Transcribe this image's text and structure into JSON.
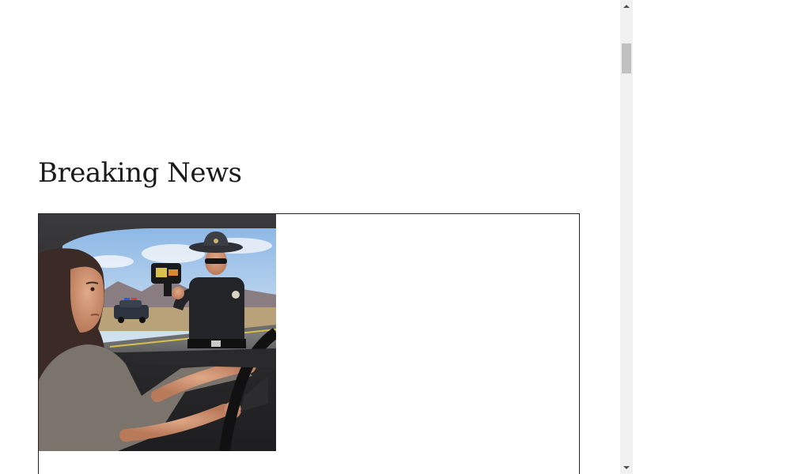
{
  "page": {
    "title": "Breaking News"
  },
  "news_card": {
    "image_alt": ""
  },
  "colors": {
    "background": "#ffffff",
    "text": "#1a1a1a",
    "card_border": "#222222",
    "scrollbar_track": "#f0f0f0",
    "scrollbar_thumb": "#c1c1c1"
  },
  "scrollbar": {
    "up_icon": "arrow-up-icon",
    "down_icon": "arrow-down-icon"
  }
}
